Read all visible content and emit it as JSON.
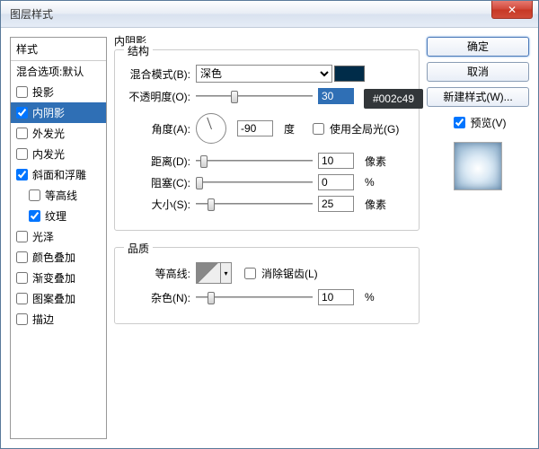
{
  "window": {
    "title": "图层样式"
  },
  "tooltip": "#002c49",
  "sidebar": {
    "header": "样式",
    "blendOptions": "混合选项:默认",
    "items": [
      {
        "label": "投影",
        "checked": false
      },
      {
        "label": "内阴影",
        "checked": true,
        "selected": true
      },
      {
        "label": "外发光",
        "checked": false
      },
      {
        "label": "内发光",
        "checked": false
      },
      {
        "label": "斜面和浮雕",
        "checked": true
      },
      {
        "label": "等高线",
        "checked": false,
        "indent": true
      },
      {
        "label": "纹理",
        "checked": true,
        "indent": true
      },
      {
        "label": "光泽",
        "checked": false
      },
      {
        "label": "颜色叠加",
        "checked": false
      },
      {
        "label": "渐变叠加",
        "checked": false
      },
      {
        "label": "图案叠加",
        "checked": false
      },
      {
        "label": "描边",
        "checked": false
      }
    ]
  },
  "main": {
    "title": "内阴影",
    "structure": {
      "legend": "结构",
      "blendModeLabel": "混合模式(B):",
      "blendModeValue": "深色",
      "swatchColor": "#002c49",
      "opacityLabel": "不透明度(O):",
      "opacityValue": "30",
      "opacityUnit": "%",
      "angleLabel": "角度(A):",
      "angleValue": "-90",
      "angleUnit": "度",
      "globalLightLabel": "使用全局光(G)",
      "globalLightChecked": false,
      "distanceLabel": "距离(D):",
      "distanceValue": "10",
      "distanceUnit": "像素",
      "chokeLabel": "阻塞(C):",
      "chokeValue": "0",
      "chokeUnit": "%",
      "sizeLabel": "大小(S):",
      "sizeValue": "25",
      "sizeUnit": "像素"
    },
    "quality": {
      "legend": "品质",
      "contourLabel": "等高线:",
      "antiAliasLabel": "消除锯齿(L)",
      "antiAliasChecked": false,
      "noiseLabel": "杂色(N):",
      "noiseValue": "10",
      "noiseUnit": "%"
    }
  },
  "right": {
    "ok": "确定",
    "cancel": "取消",
    "newStyle": "新建样式(W)...",
    "previewLabel": "预览(V)",
    "previewChecked": true
  }
}
